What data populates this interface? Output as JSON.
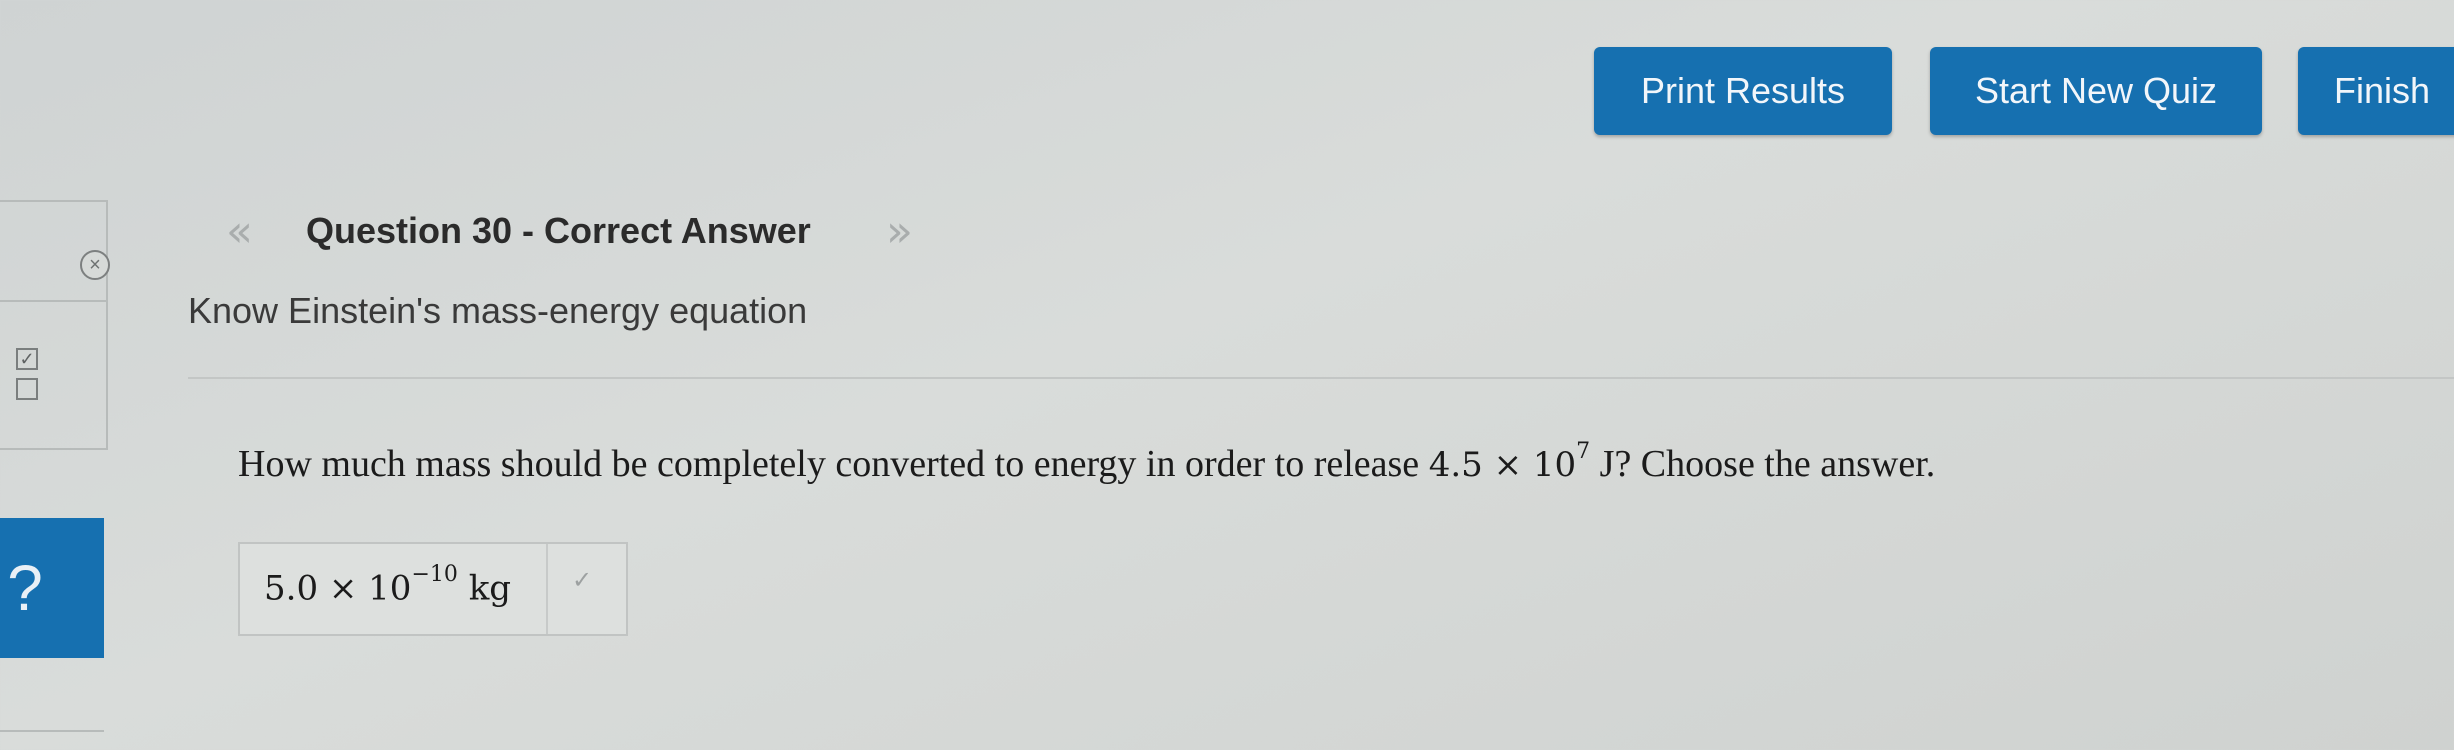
{
  "toolbar": {
    "print_label": "Print Results",
    "new_quiz_label": "Start New Quiz",
    "finish_label": "Finish"
  },
  "sidebar": {
    "close_glyph": "×",
    "check_on_glyph": "✓",
    "help_glyph": "?"
  },
  "question": {
    "prev_glyph": "«",
    "next_glyph": "»",
    "title": "Question 30 - Correct Answer",
    "subtitle": "Know Einstein's mass-energy equation",
    "text_before": "How much mass should be completely converted to energy in order to release ",
    "energy_coefficient": "4.5 × 10",
    "energy_exponent": "7",
    "energy_unit": " J",
    "text_after": "? Choose the answer."
  },
  "answer": {
    "coefficient": "5.0 × 10",
    "exponent": "−10",
    "unit": " kg",
    "status_glyph": "✓"
  },
  "colors": {
    "accent": "#1670b0",
    "background": "#d6d9d7"
  },
  "icons": [
    "close-icon",
    "checkbox-checked-icon",
    "checkbox-empty-icon",
    "help-icon",
    "chevron-left-double-icon",
    "chevron-right-double-icon",
    "check-icon"
  ]
}
